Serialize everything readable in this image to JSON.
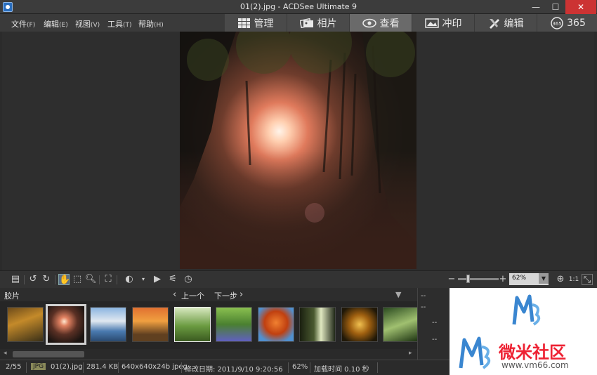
{
  "window": {
    "title": "01(2).jpg - ACDSee Ultimate 9",
    "minimize": "—",
    "maximize": "☐",
    "close": "✕"
  },
  "menus": [
    {
      "label": "文件",
      "acc": "(F)"
    },
    {
      "label": "编辑",
      "acc": "(E)"
    },
    {
      "label": "视图",
      "acc": "(V)"
    },
    {
      "label": "工具",
      "acc": "(T)"
    },
    {
      "label": "帮助",
      "acc": "(H)"
    }
  ],
  "modes": [
    {
      "label": "管理",
      "icon": "grid-icon"
    },
    {
      "label": "相片",
      "icon": "photos-icon"
    },
    {
      "label": "查看",
      "icon": "eye-icon",
      "active": true
    },
    {
      "label": "冲印",
      "icon": "develop-icon"
    },
    {
      "label": "编辑",
      "icon": "edit-icon"
    },
    {
      "label": "365",
      "icon": "cloud-365-icon"
    }
  ],
  "toolbar": {
    "zoom_value": "62%",
    "zoom_minus": "−",
    "zoom_plus": "+",
    "ratio_label": "1:1"
  },
  "filmstrip": {
    "label": "胶片",
    "prev": "上一个",
    "next": "下一步",
    "thumbnails": [
      {
        "name": "autumn-forest"
      },
      {
        "name": "sunlit-forest",
        "selected": true
      },
      {
        "name": "birch-lake"
      },
      {
        "name": "sunset-trees"
      },
      {
        "name": "park-lawn"
      },
      {
        "name": "bluebell-wood"
      },
      {
        "name": "red-tree"
      },
      {
        "name": "dark-forest"
      },
      {
        "name": "golden-path"
      },
      {
        "name": "green-ferns"
      }
    ]
  },
  "properties": {
    "rows": [
      "--",
      "--",
      "--",
      "--"
    ]
  },
  "status": {
    "index": "2/55",
    "format": "JPG",
    "filename": "01(2).jpg",
    "filesize": "281.4 KB",
    "dimensions": "640x640x24b jpeg",
    "modified": "修改日期: 2011/9/10 9:20:56",
    "zoom": "62%",
    "load_time": "加载时间 0.10 秒"
  },
  "watermark": {
    "brand": "微米社区",
    "url": "www.vm66.com"
  }
}
